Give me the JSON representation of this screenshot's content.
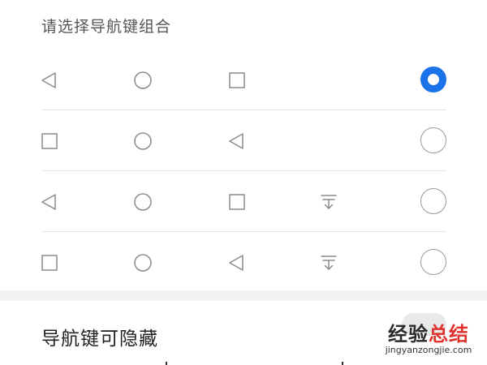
{
  "section_title": "请选择导航键组合",
  "accent_color": "#1a73e8",
  "options": [
    {
      "icons": [
        "back-triangle-icon",
        "home-circle-icon",
        "recent-square-icon"
      ],
      "selected": true
    },
    {
      "icons": [
        "recent-square-icon",
        "home-circle-icon",
        "back-triangle-icon"
      ],
      "selected": false
    },
    {
      "icons": [
        "back-triangle-icon",
        "home-circle-icon",
        "recent-square-icon",
        "notification-pull-down-icon"
      ],
      "selected": false
    },
    {
      "icons": [
        "recent-square-icon",
        "home-circle-icon",
        "back-triangle-icon",
        "notification-pull-down-icon"
      ],
      "selected": false
    }
  ],
  "hide_setting": {
    "label": "导航键可隐藏"
  },
  "watermark": {
    "part1": "经验",
    "part2": "总结",
    "url": "jingyanzongjie.com"
  }
}
